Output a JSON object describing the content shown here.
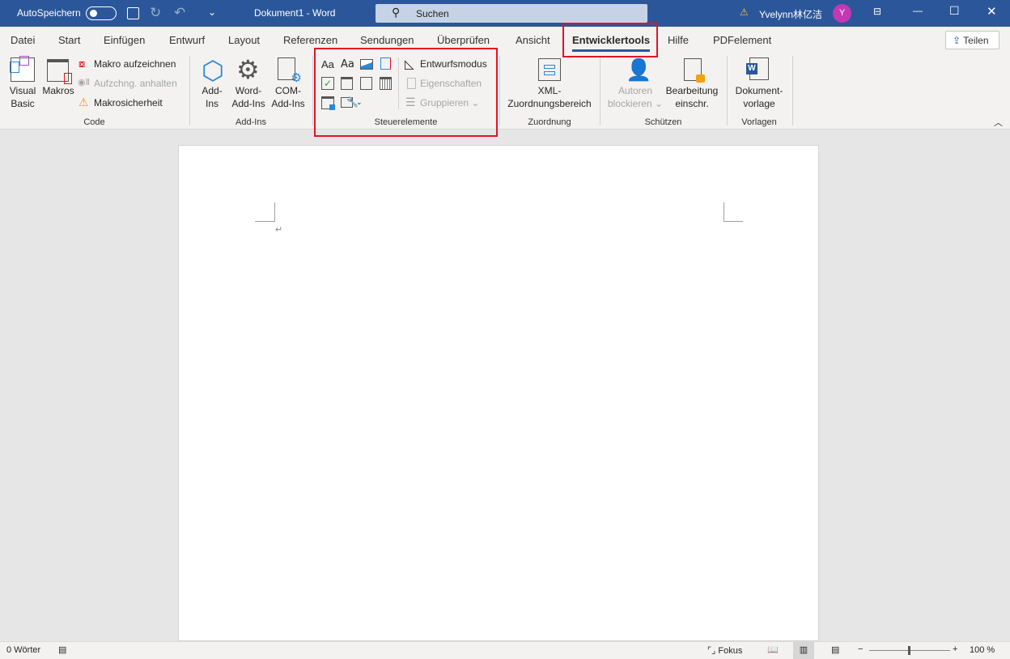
{
  "titlebar": {
    "autosave_label": "AutoSpeichern",
    "autosave_on": false,
    "doc_title": "Dokument1  -  Word",
    "search_placeholder": "Suchen",
    "user_name": "Yvelynn林亿洁",
    "avatar_initial": "Y",
    "accent": "#2b579a"
  },
  "tabs": [
    "Datei",
    "Start",
    "Einfügen",
    "Entwurf",
    "Layout",
    "Referenzen",
    "Sendungen",
    "Überprüfen",
    "Ansicht",
    "Entwicklertools",
    "Hilfe",
    "PDFelement"
  ],
  "active_tab": "Entwicklertools",
  "share_label": "Teilen",
  "ribbon": {
    "code": {
      "label": "Code",
      "visual_basic": [
        "Visual",
        "Basic"
      ],
      "macros": "Makros",
      "record": "Makro aufzeichnen",
      "pause": "Aufzchng. anhalten",
      "security": "Makrosicherheit"
    },
    "addins": {
      "label": "Add-Ins",
      "addins": [
        "Add-",
        "Ins"
      ],
      "word_addins": [
        "Word-",
        "Add-Ins"
      ],
      "com_addins": [
        "COM-",
        "Add-Ins"
      ]
    },
    "controls": {
      "label": "Steuerelemente",
      "design_mode": "Entwurfsmodus",
      "properties": "Eigenschaften",
      "group": "Gruppieren",
      "rich_text": "Aa",
      "plain_text": "Aa"
    },
    "mapping": {
      "label": "Zuordnung",
      "xml": [
        "XML-",
        "Zuordnungsbereich"
      ]
    },
    "protect": {
      "label": "Schützen",
      "block_authors": [
        "Autoren",
        "blockieren"
      ],
      "restrict": [
        "Bearbeitung",
        "einschr."
      ]
    },
    "templates": {
      "label": "Vorlagen",
      "doc_template": [
        "Dokument-",
        "vorlage"
      ]
    }
  },
  "status": {
    "words": "0 Wörter",
    "focus": "Fokus",
    "zoom": "100 %",
    "zoom_percent": 100
  }
}
